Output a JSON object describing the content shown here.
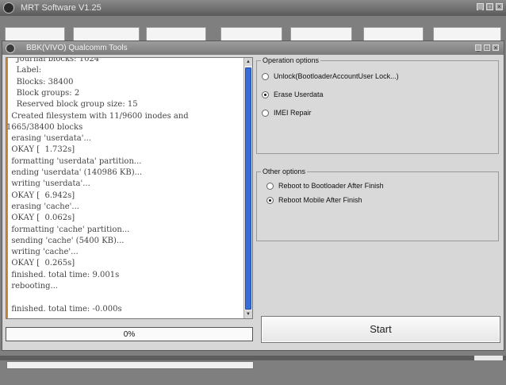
{
  "outer_window": {
    "title": "MRT Software V1.25"
  },
  "inner_window": {
    "title": "BBK(VIVO) Qualcomm Tools"
  },
  "log": {
    "lines": [
      "    Journal blocks: 1024",
      "    Label:",
      "    Blocks: 38400",
      "    Block groups: 2",
      "    Reserved block group size: 15",
      "  Created filesystem with 11/9600 inodes and",
      "1665/38400 blocks",
      "  erasing 'userdata'...",
      "  OKAY [  1.732s]",
      "  formatting 'userdata' partition...",
      "  ending 'userdata' (140986 KB)...",
      "  writing 'userdata'...",
      "  OKAY [  6.942s]",
      "  erasing 'cache'...",
      "  OKAY [  0.062s]",
      "  formatting 'cache' partition...",
      "  sending 'cache' (5400 KB)...",
      "  writing 'cache'...",
      "  OKAY [  0.265s]",
      "  finished. total time: 9.001s",
      "  rebooting...",
      "",
      "  finished. total time: -0.000s"
    ],
    "scroll_position": 0.98
  },
  "progress": {
    "label": "0%",
    "value": 0
  },
  "operation_options": {
    "legend": "Operation options",
    "options": [
      {
        "label": "Unlock(BootloaderAccountUser Lock...)",
        "checked": false
      },
      {
        "label": "Erase Userdata",
        "checked": true
      },
      {
        "label": "IMEI Repair",
        "checked": false
      }
    ]
  },
  "other_options": {
    "legend": "Other options",
    "options": [
      {
        "label": "Reboot to Bootloader After Finish",
        "checked": false
      },
      {
        "label": "Reboot Mobile After Finish",
        "checked": true
      }
    ]
  },
  "start_button": {
    "label": "Start"
  },
  "window_controls": [
    "minimize-icon",
    "maximize-icon",
    "close-icon"
  ]
}
